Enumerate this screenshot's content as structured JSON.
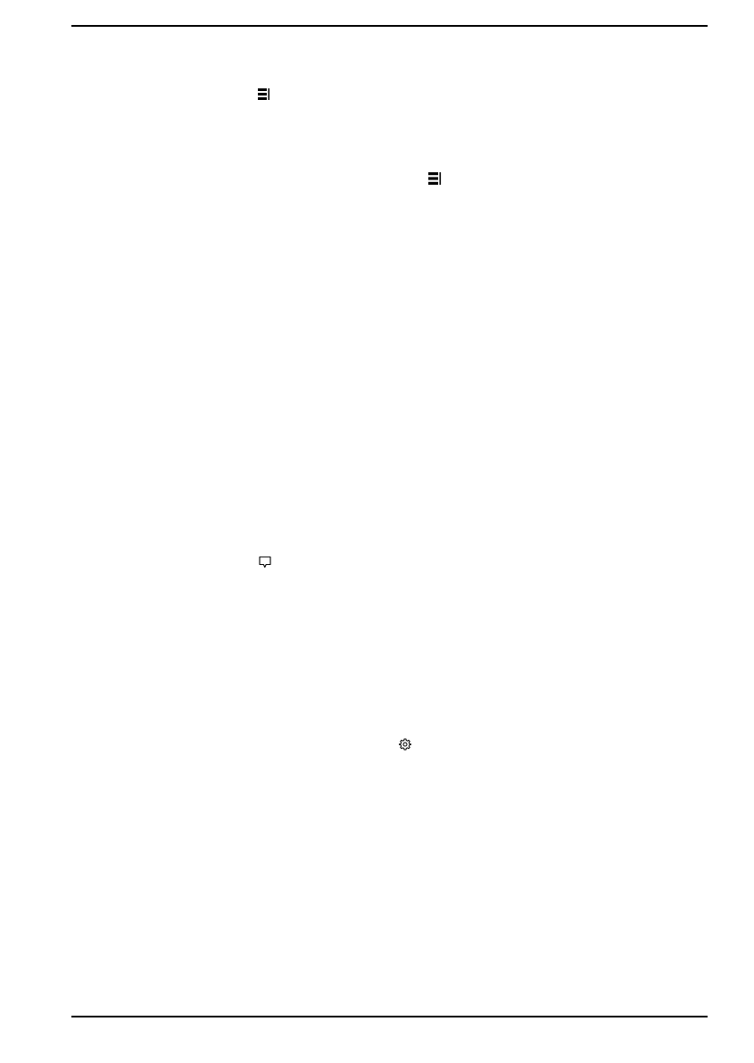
{
  "page": {
    "icons": [
      {
        "id": "task-view-icon-1",
        "name": "task-view-icon"
      },
      {
        "id": "task-view-icon-2",
        "name": "task-view-icon"
      },
      {
        "id": "action-center-icon",
        "name": "action-center-icon"
      },
      {
        "id": "settings-icon",
        "name": "gear-icon"
      }
    ],
    "colors": {
      "ink": "#000000",
      "paper": "#ffffff"
    }
  }
}
